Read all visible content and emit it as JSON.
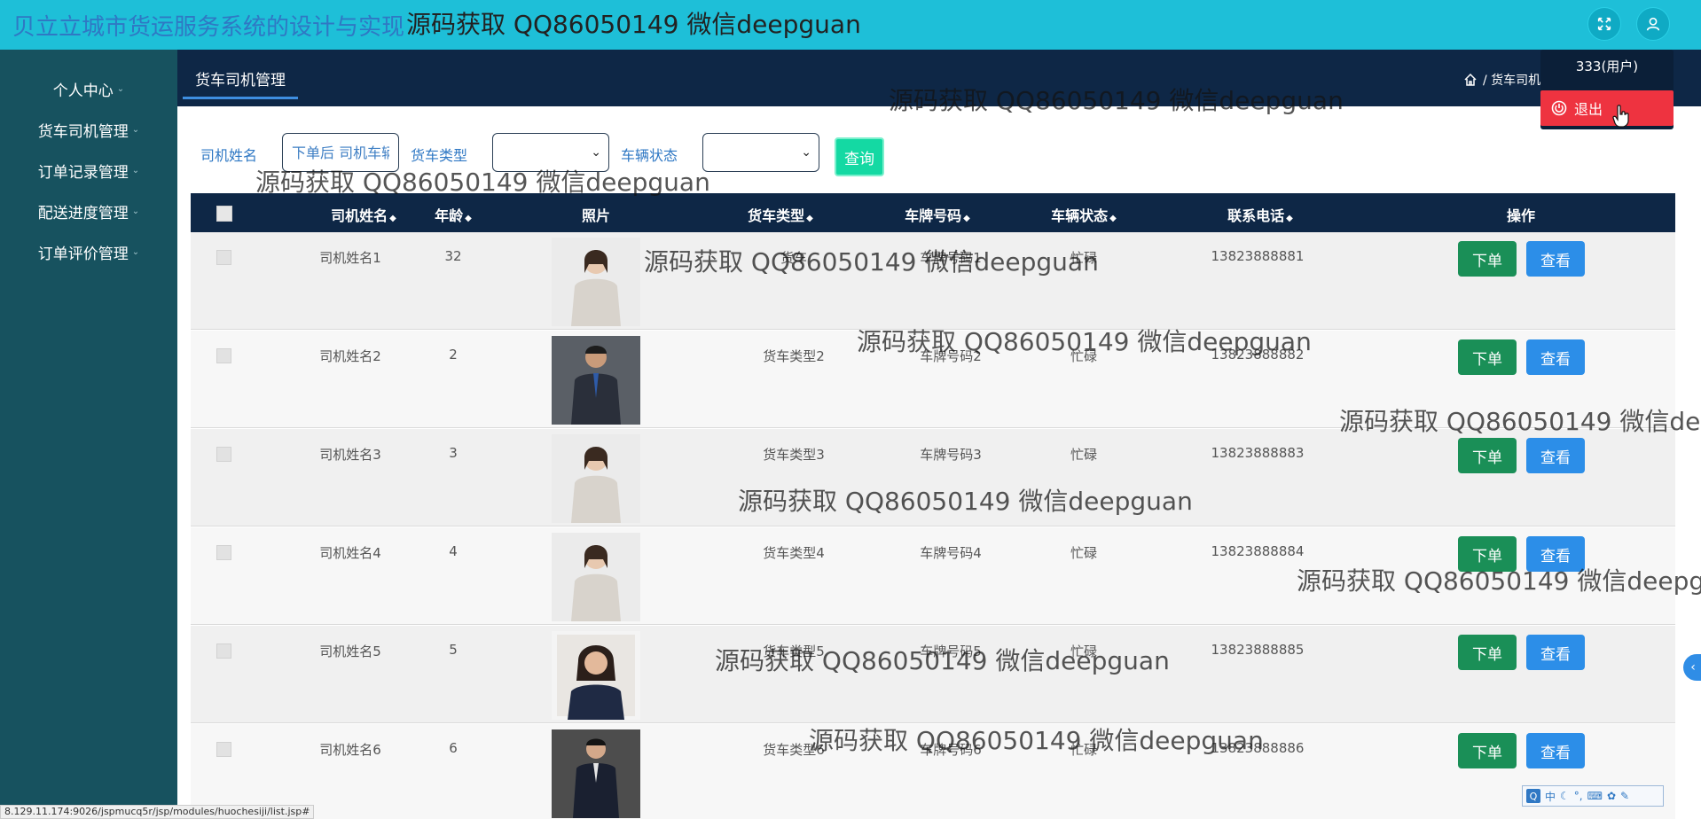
{
  "header": {
    "title": "贝立立城市货运服务系统的设计与实现",
    "title_extra": "源码获取 QQ86050149 微信deepguan",
    "fullscreen_icon": "expand-icon",
    "user_icon": "user-icon"
  },
  "user_menu": {
    "username": "333(用户)",
    "logout_label": "退出"
  },
  "sidebar": {
    "items": [
      {
        "label": "个人中心"
      },
      {
        "label": "货车司机管理"
      },
      {
        "label": "订单记录管理"
      },
      {
        "label": "配送进度管理"
      },
      {
        "label": "订单评价管理"
      }
    ]
  },
  "page": {
    "tab_label": "货车司机管理",
    "breadcrumb": "/ 货车司机"
  },
  "search": {
    "driver_name_label": "司机姓名",
    "driver_name_placeholder": "下单后 司机车辆",
    "truck_type_label": "货车类型",
    "vehicle_status_label": "车辆状态",
    "query_label": "查询"
  },
  "table": {
    "columns": [
      "司机姓名",
      "年龄",
      "照片",
      "货车类型",
      "车牌号码",
      "车辆状态",
      "联系电话",
      "操作"
    ],
    "rows": [
      {
        "name": "司机姓名1",
        "age": "32",
        "truck_type": "货车",
        "plate": "车牌号码1",
        "status": "忙碌",
        "phone": "13823888881",
        "order": "下单",
        "view": "查看"
      },
      {
        "name": "司机姓名2",
        "age": "2",
        "truck_type": "货车类型2",
        "plate": "车牌号码2",
        "status": "忙碌",
        "phone": "13823888882",
        "order": "下单",
        "view": "查看"
      },
      {
        "name": "司机姓名3",
        "age": "3",
        "truck_type": "货车类型3",
        "plate": "车牌号码3",
        "status": "忙碌",
        "phone": "13823888883",
        "order": "下单",
        "view": "查看"
      },
      {
        "name": "司机姓名4",
        "age": "4",
        "truck_type": "货车类型4",
        "plate": "车牌号码4",
        "status": "忙碌",
        "phone": "13823888884",
        "order": "下单",
        "view": "查看"
      },
      {
        "name": "司机姓名5",
        "age": "5",
        "truck_type": "货车类型5",
        "plate": "车牌号码5",
        "status": "忙碌",
        "phone": "13823888885",
        "order": "下单",
        "view": "查看"
      },
      {
        "name": "司机姓名6",
        "age": "6",
        "truck_type": "货车类型6",
        "plate": "车牌号码6",
        "status": "忙碌",
        "phone": "13823888886",
        "order": "下单",
        "view": "查看"
      }
    ]
  },
  "watermark": "源码获取 QQ86050149 微信deepguan",
  "status_bar": "8.129.11.174:9026/jspmucq5r/jsp/modules/huochesiji/list.jsp#",
  "ime": {
    "logo": "Q",
    "mode": "中"
  },
  "colors": {
    "topbar": "#1ebfd8",
    "sidebar": "#17525f",
    "header_dark": "#0e2746",
    "query_button": "#14d9a3",
    "order_button": "#1a8f57",
    "view_button": "#2c8ee8",
    "logout_button": "#ee3340"
  }
}
